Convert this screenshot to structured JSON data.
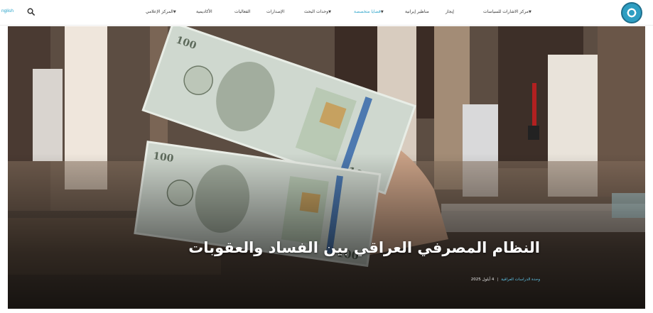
{
  "header": {
    "language_link": "nglish",
    "logo_icon": "center-logo",
    "accent_color": "#2aa3c9",
    "nav": [
      {
        "label": "مركز الاشارات للسياسات",
        "has_dropdown": true
      },
      {
        "label": "إيجاز",
        "has_dropdown": false
      },
      {
        "label": "مناظير إيرانية",
        "has_dropdown": false
      },
      {
        "label": "قضايا متخصصة",
        "has_dropdown": true,
        "active": true
      },
      {
        "label": "وحدات البحث",
        "has_dropdown": true
      },
      {
        "label": "الإصدارات",
        "has_dropdown": false
      },
      {
        "label": "الفعاليات",
        "has_dropdown": false
      },
      {
        "label": "الأكاديمية",
        "has_dropdown": false
      },
      {
        "label": "المركز الإعلامي",
        "has_dropdown": true
      }
    ]
  },
  "hero": {
    "title": "النظام المصرفي العراقي بين الفساد والعقوبات",
    "unit": "وحدة الدراسات العراقية",
    "date": "4 أيلول 2025"
  }
}
